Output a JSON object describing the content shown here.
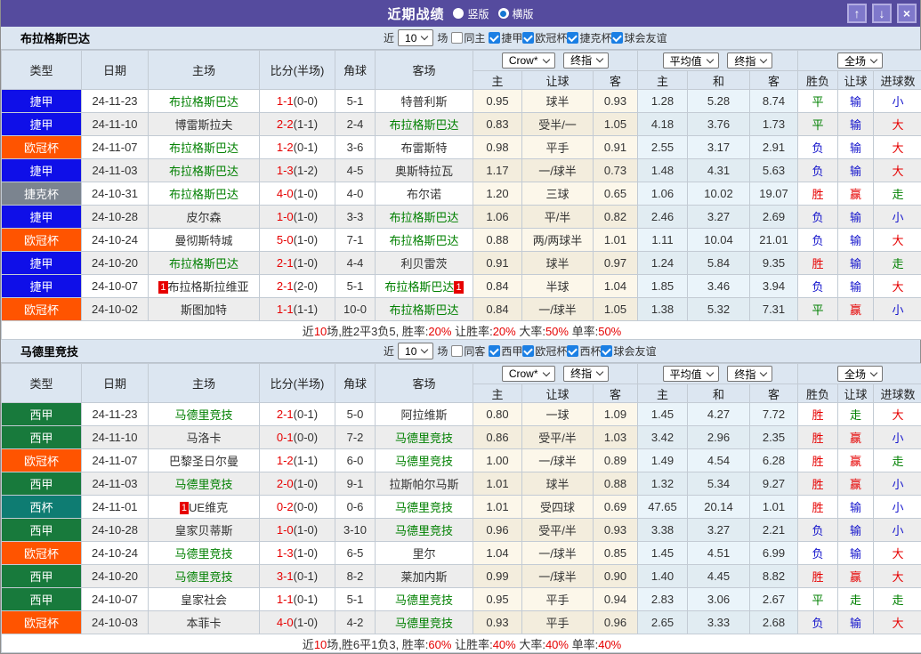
{
  "titlebar": {
    "title": "近期战绩",
    "radios": [
      {
        "label": "竖版",
        "selected": false
      },
      {
        "label": "横版",
        "selected": true
      }
    ],
    "buttons": {
      "up": "↑",
      "down": "↓",
      "close": "×"
    },
    "bar_color": "#554b9e"
  },
  "table_header": {
    "type": "类型",
    "date": "日期",
    "home": "主场",
    "score": "比分(半场)",
    "corner": "角球",
    "away": "客场",
    "crow_select": "Crow*",
    "final_select": "终指",
    "avg_select": "平均值",
    "final_select2": "终指",
    "full_select": "全场",
    "sub": [
      "主",
      "让球",
      "客",
      "主",
      "和",
      "客",
      "胜负",
      "让球",
      "进球数"
    ]
  },
  "league_colors": {
    "捷甲": "#0f0fe8",
    "欧冠杯": "#ff5400",
    "捷克杯": "#7b848f",
    "西甲": "#187a3c",
    "西杯": "#0e7c72"
  },
  "outcome_colors": {
    "胜": "red",
    "赢": "red",
    "大": "red",
    "平": "green",
    "走": "green",
    "负": "blue",
    "输": "blue",
    "小": "blue"
  },
  "sections": [
    {
      "team": "布拉格斯巴达",
      "filter": {
        "near": "近",
        "count": "10",
        "games": "场",
        "same": "同主",
        "same_checked": false,
        "leagues": [
          "捷甲",
          "欧冠杯",
          "捷克杯",
          "球会友谊"
        ]
      },
      "rows": [
        {
          "league": "捷甲",
          "date": "24-11-23",
          "home": "布拉格斯巴达",
          "home_green": true,
          "score": "1-1",
          "half": "(0-0)",
          "corner": "5-1",
          "away": "特普利斯",
          "away_green": false,
          "odds": [
            "0.95",
            "球半",
            "0.93",
            "1.28",
            "5.28",
            "8.74"
          ],
          "outcome": [
            "平",
            "输",
            "小"
          ]
        },
        {
          "league": "捷甲",
          "date": "24-11-10",
          "home": "博雷斯拉夫",
          "home_green": false,
          "score": "2-2",
          "half": "(1-1)",
          "corner": "2-4",
          "away": "布拉格斯巴达",
          "away_green": true,
          "odds": [
            "0.83",
            "受半/一",
            "1.05",
            "4.18",
            "3.76",
            "1.73"
          ],
          "outcome": [
            "平",
            "输",
            "大"
          ]
        },
        {
          "league": "欧冠杯",
          "date": "24-11-07",
          "home": "布拉格斯巴达",
          "home_green": true,
          "score": "1-2",
          "half": "(0-1)",
          "corner": "3-6",
          "away": "布雷斯特",
          "away_green": false,
          "odds": [
            "0.98",
            "平手",
            "0.91",
            "2.55",
            "3.17",
            "2.91"
          ],
          "outcome": [
            "负",
            "输",
            "大"
          ]
        },
        {
          "league": "捷甲",
          "date": "24-11-03",
          "home": "布拉格斯巴达",
          "home_green": true,
          "score": "1-3",
          "half": "(1-2)",
          "corner": "4-5",
          "away": "奥斯特拉瓦",
          "away_green": false,
          "odds": [
            "1.17",
            "一/球半",
            "0.73",
            "1.48",
            "4.31",
            "5.63"
          ],
          "outcome": [
            "负",
            "输",
            "大"
          ]
        },
        {
          "league": "捷克杯",
          "date": "24-10-31",
          "home": "布拉格斯巴达",
          "home_green": true,
          "score": "4-0",
          "half": "(1-0)",
          "corner": "4-0",
          "away": "布尔诺",
          "away_green": false,
          "odds": [
            "1.20",
            "三球",
            "0.65",
            "1.06",
            "10.02",
            "19.07"
          ],
          "outcome": [
            "胜",
            "赢",
            "走"
          ]
        },
        {
          "league": "捷甲",
          "date": "24-10-28",
          "home": "皮尔森",
          "home_green": false,
          "score": "1-0",
          "half": "(1-0)",
          "corner": "3-3",
          "away": "布拉格斯巴达",
          "away_green": true,
          "odds": [
            "1.06",
            "平/半",
            "0.82",
            "2.46",
            "3.27",
            "2.69"
          ],
          "outcome": [
            "负",
            "输",
            "小"
          ]
        },
        {
          "league": "欧冠杯",
          "date": "24-10-24",
          "home": "曼彻斯特城",
          "home_green": false,
          "score": "5-0",
          "half": "(1-0)",
          "corner": "7-1",
          "away": "布拉格斯巴达",
          "away_green": true,
          "odds": [
            "0.88",
            "两/两球半",
            "1.01",
            "1.11",
            "10.04",
            "21.01"
          ],
          "outcome": [
            "负",
            "输",
            "大"
          ]
        },
        {
          "league": "捷甲",
          "date": "24-10-20",
          "home": "布拉格斯巴达",
          "home_green": true,
          "score": "2-1",
          "half": "(1-0)",
          "corner": "4-4",
          "away": "利贝雷茨",
          "away_green": false,
          "odds": [
            "0.91",
            "球半",
            "0.97",
            "1.24",
            "5.84",
            "9.35"
          ],
          "outcome": [
            "胜",
            "输",
            "走"
          ]
        },
        {
          "league": "捷甲",
          "date": "24-10-07",
          "home": "布拉格斯拉维亚",
          "home_green": false,
          "home_rank": "1",
          "score": "2-1",
          "half": "(2-0)",
          "corner": "5-1",
          "away": "布拉格斯巴达",
          "away_green": true,
          "away_rank": "1",
          "odds": [
            "0.84",
            "半球",
            "1.04",
            "1.85",
            "3.46",
            "3.94"
          ],
          "outcome": [
            "负",
            "输",
            "大"
          ]
        },
        {
          "league": "欧冠杯",
          "date": "24-10-02",
          "home": "斯图加特",
          "home_green": false,
          "score": "1-1",
          "half": "(1-1)",
          "corner": "10-0",
          "away": "布拉格斯巴达",
          "away_green": true,
          "odds": [
            "0.84",
            "一/球半",
            "1.05",
            "1.38",
            "5.32",
            "7.31"
          ],
          "outcome": [
            "平",
            "赢",
            "小"
          ]
        }
      ],
      "summary": [
        {
          "t": "近",
          "r": false
        },
        {
          "t": "10",
          "r": true
        },
        {
          "t": "场,胜2平3负5, 胜率:",
          "r": false
        },
        {
          "t": "20%",
          "r": true
        },
        {
          "t": " 让胜率:",
          "r": false
        },
        {
          "t": "20%",
          "r": true
        },
        {
          "t": " 大率:",
          "r": false
        },
        {
          "t": "50%",
          "r": true
        },
        {
          "t": " 单率:",
          "r": false
        },
        {
          "t": "50%",
          "r": true
        }
      ]
    },
    {
      "team": "马德里竞技",
      "filter": {
        "near": "近",
        "count": "10",
        "games": "场",
        "same": "同客",
        "same_checked": false,
        "leagues": [
          "西甲",
          "欧冠杯",
          "西杯",
          "球会友谊"
        ]
      },
      "rows": [
        {
          "league": "西甲",
          "date": "24-11-23",
          "home": "马德里竞技",
          "home_green": true,
          "score": "2-1",
          "half": "(0-1)",
          "corner": "5-0",
          "away": "阿拉维斯",
          "away_green": false,
          "odds": [
            "0.80",
            "一球",
            "1.09",
            "1.45",
            "4.27",
            "7.72"
          ],
          "outcome": [
            "胜",
            "走",
            "大"
          ]
        },
        {
          "league": "西甲",
          "date": "24-11-10",
          "home": "马洛卡",
          "home_green": false,
          "score": "0-1",
          "half": "(0-0)",
          "corner": "7-2",
          "away": "马德里竞技",
          "away_green": true,
          "odds": [
            "0.86",
            "受平/半",
            "1.03",
            "3.42",
            "2.96",
            "2.35"
          ],
          "outcome": [
            "胜",
            "赢",
            "小"
          ]
        },
        {
          "league": "欧冠杯",
          "date": "24-11-07",
          "home": "巴黎圣日尔曼",
          "home_green": false,
          "score": "1-2",
          "half": "(1-1)",
          "corner": "6-0",
          "away": "马德里竞技",
          "away_green": true,
          "odds": [
            "1.00",
            "一/球半",
            "0.89",
            "1.49",
            "4.54",
            "6.28"
          ],
          "outcome": [
            "胜",
            "赢",
            "走"
          ]
        },
        {
          "league": "西甲",
          "date": "24-11-03",
          "home": "马德里竞技",
          "home_green": true,
          "score": "2-0",
          "half": "(1-0)",
          "corner": "9-1",
          "away": "拉斯帕尔马斯",
          "away_green": false,
          "odds": [
            "1.01",
            "球半",
            "0.88",
            "1.32",
            "5.34",
            "9.27"
          ],
          "outcome": [
            "胜",
            "赢",
            "小"
          ]
        },
        {
          "league": "西杯",
          "date": "24-11-01",
          "home": "UE维克",
          "home_green": false,
          "home_rank": "1",
          "score": "0-2",
          "half": "(0-0)",
          "corner": "0-6",
          "away": "马德里竞技",
          "away_green": true,
          "odds": [
            "1.01",
            "受四球",
            "0.69",
            "47.65",
            "20.14",
            "1.01"
          ],
          "outcome": [
            "胜",
            "输",
            "小"
          ]
        },
        {
          "league": "西甲",
          "date": "24-10-28",
          "home": "皇家贝蒂斯",
          "home_green": false,
          "score": "1-0",
          "half": "(1-0)",
          "corner": "3-10",
          "away": "马德里竞技",
          "away_green": true,
          "odds": [
            "0.96",
            "受平/半",
            "0.93",
            "3.38",
            "3.27",
            "2.21"
          ],
          "outcome": [
            "负",
            "输",
            "小"
          ]
        },
        {
          "league": "欧冠杯",
          "date": "24-10-24",
          "home": "马德里竞技",
          "home_green": true,
          "score": "1-3",
          "half": "(1-0)",
          "corner": "6-5",
          "away": "里尔",
          "away_green": false,
          "odds": [
            "1.04",
            "一/球半",
            "0.85",
            "1.45",
            "4.51",
            "6.99"
          ],
          "outcome": [
            "负",
            "输",
            "大"
          ]
        },
        {
          "league": "西甲",
          "date": "24-10-20",
          "home": "马德里竞技",
          "home_green": true,
          "score": "3-1",
          "half": "(0-1)",
          "corner": "8-2",
          "away": "莱加内斯",
          "away_green": false,
          "odds": [
            "0.99",
            "一/球半",
            "0.90",
            "1.40",
            "4.45",
            "8.82"
          ],
          "outcome": [
            "胜",
            "赢",
            "大"
          ]
        },
        {
          "league": "西甲",
          "date": "24-10-07",
          "home": "皇家社会",
          "home_green": false,
          "score": "1-1",
          "half": "(0-1)",
          "corner": "5-1",
          "away": "马德里竞技",
          "away_green": true,
          "odds": [
            "0.95",
            "平手",
            "0.94",
            "2.83",
            "3.06",
            "2.67"
          ],
          "outcome": [
            "平",
            "走",
            "走"
          ]
        },
        {
          "league": "欧冠杯",
          "date": "24-10-03",
          "home": "本菲卡",
          "home_green": false,
          "score": "4-0",
          "half": "(1-0)",
          "corner": "4-2",
          "away": "马德里竞技",
          "away_green": true,
          "odds": [
            "0.93",
            "平手",
            "0.96",
            "2.65",
            "3.33",
            "2.68"
          ],
          "outcome": [
            "负",
            "输",
            "大"
          ]
        }
      ],
      "summary": [
        {
          "t": "近",
          "r": false
        },
        {
          "t": "10",
          "r": true
        },
        {
          "t": "场,胜6平1负3, 胜率:",
          "r": false
        },
        {
          "t": "60%",
          "r": true
        },
        {
          "t": " 让胜率:",
          "r": false
        },
        {
          "t": "40%",
          "r": true
        },
        {
          "t": " 大率:",
          "r": false
        },
        {
          "t": "40%",
          "r": true
        },
        {
          "t": " 单率:",
          "r": false
        },
        {
          "t": "40%",
          "r": true
        }
      ]
    }
  ]
}
